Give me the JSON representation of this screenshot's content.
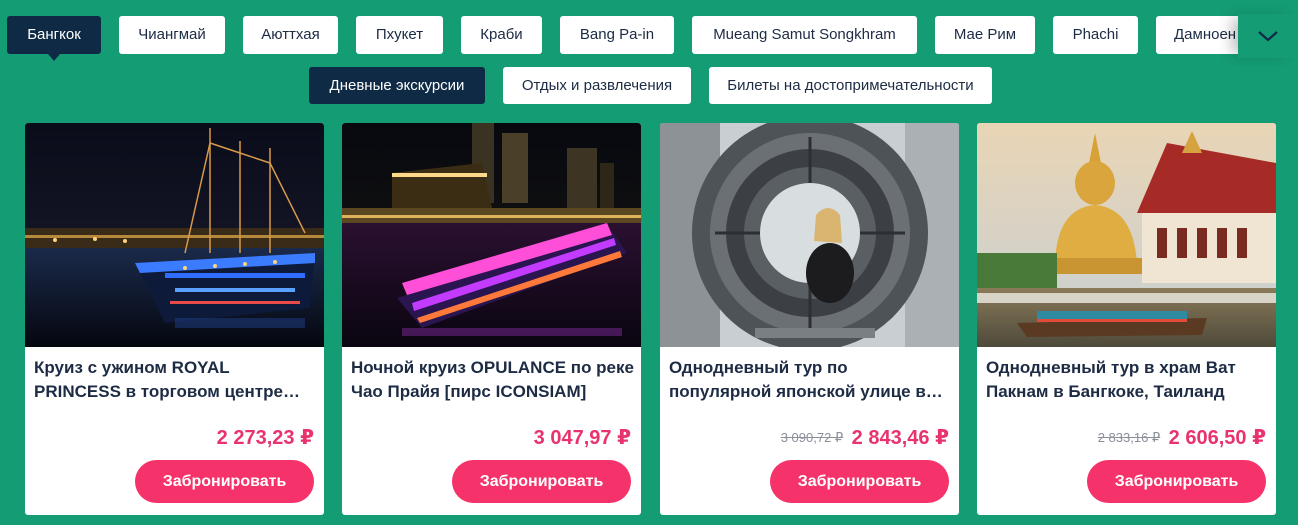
{
  "city_tabs": [
    "Бангкок",
    "Чиангмай",
    "Аюттхая",
    "Пхукет",
    "Краби",
    "Bang Pa-in",
    "Mueang Samut Songkhram",
    "Мае Рим",
    "Phachi",
    "Дамноен Садуак"
  ],
  "category_tabs": [
    "Дневные экскурсии",
    "Отдых и развлечения",
    "Билеты на достопримечательности"
  ],
  "book_label": "Забронировать",
  "colors": {
    "background": "#149c74",
    "active_tab": "#0f2a45",
    "price": "#e8336d",
    "button": "#f5336a"
  },
  "cards": [
    {
      "title": "Круиз с ужином ROYAL PRINCESS в торговом центре Asiatique The Riverfront",
      "old_price": "",
      "price": "2 273,23 ₽"
    },
    {
      "title": "Ночной круиз OPULANCE по реке Чао Прайя [пирс ICONSIAM]",
      "old_price": "",
      "price": "3 047,97 ₽"
    },
    {
      "title": "Однодневный тур по популярной японской улице в Банг Саен-Бичс",
      "old_price": "3 090,72 ₽",
      "price": "2 843,46 ₽"
    },
    {
      "title": "Однодневный тур в храм Ват Пакнам в Бангкоке, Таиланд",
      "old_price": "2 833,16 ₽",
      "price": "2 606,50 ₽"
    }
  ]
}
